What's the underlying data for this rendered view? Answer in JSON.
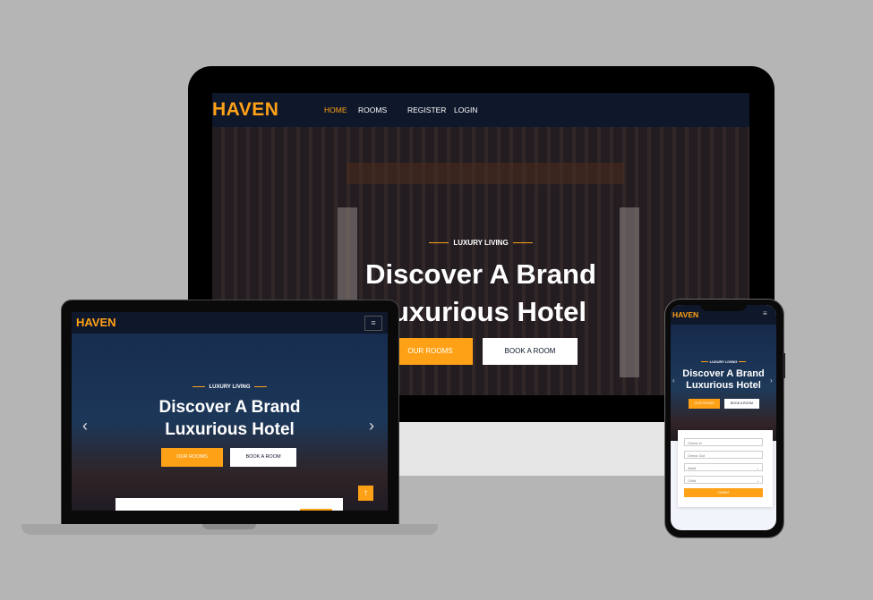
{
  "desktop": {
    "logo": "HAVEN",
    "nav": [
      {
        "label": "HOME",
        "active": true
      },
      {
        "label": "ROOMS",
        "active": false
      },
      {
        "label": "REGISTER",
        "active": false
      },
      {
        "label": "LOGIN",
        "active": false
      }
    ],
    "hero": {
      "kicker": "LUXURY LIVING",
      "title_line1": "Discover A Brand",
      "title_line2": "Luxurious Hotel",
      "btn_primary": "OUR ROOMS",
      "btn_secondary": "BOOK A ROOM"
    }
  },
  "laptop": {
    "logo": "HAVEN",
    "menu_icon": "≡",
    "hero": {
      "kicker": "LUXURY LIVING",
      "title_line1": "Discover A Brand",
      "title_line2": "Luxurious Hotel",
      "btn_primary": "OUR ROOMS",
      "btn_secondary": "BOOK A ROOM",
      "prev": "‹",
      "next": "›"
    },
    "back_to_top": "↑"
  },
  "phone": {
    "logo": "HAVEN",
    "menu_icon": "≡",
    "hero": {
      "kicker": "LUXURY LIVING",
      "title_line1": "Discover A Brand",
      "title_line2": "Luxurious Hotel",
      "btn_primary": "OUR ROOMS",
      "btn_secondary": "BOOK A ROOM",
      "prev": "‹",
      "next": "›"
    },
    "booking": {
      "check_in_placeholder": "Check In",
      "check_out_placeholder": "Check Out",
      "adult_select": "Adult",
      "child_select": "Child",
      "submit": "SUBMIT"
    }
  },
  "colors": {
    "accent": "#fea116",
    "navy": "#0f172b",
    "background": "#b5b5b5"
  }
}
